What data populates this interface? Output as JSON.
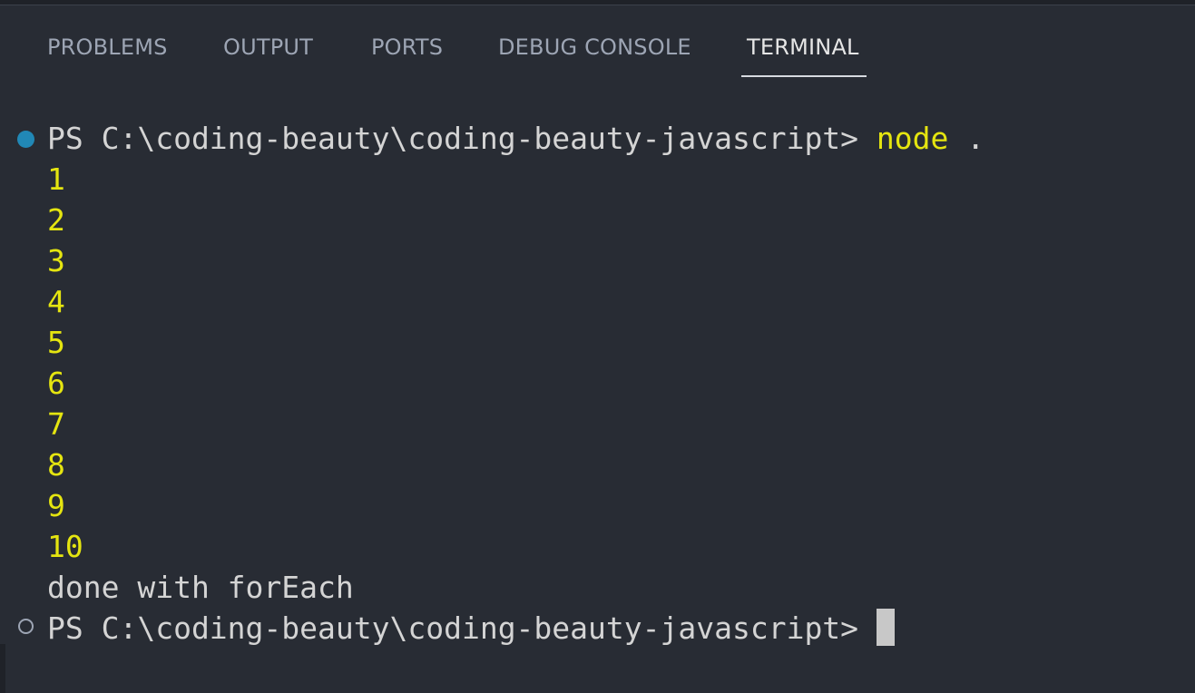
{
  "tabs": [
    {
      "label": "PROBLEMS",
      "active": false
    },
    {
      "label": "OUTPUT",
      "active": false
    },
    {
      "label": "PORTS",
      "active": false
    },
    {
      "label": "DEBUG CONSOLE",
      "active": false
    },
    {
      "label": "TERMINAL",
      "active": true
    }
  ],
  "terminal": {
    "prompt": "PS C:\\coding-beauty\\coding-beauty-javascript> ",
    "command": "node",
    "command_arg": " .",
    "output_numbers": [
      "1",
      "2",
      "3",
      "4",
      "5",
      "6",
      "7",
      "8",
      "9",
      "10"
    ],
    "output_text": "done with forEach",
    "final_prompt": "PS C:\\coding-beauty\\coding-beauty-javascript> "
  },
  "colors": {
    "background": "#282c34",
    "output_yellow": "#e5e510",
    "text": "#d4d4d4",
    "decoration_success": "#2188b6"
  },
  "icons": {
    "command_decoration_done": "circle-filled-icon",
    "command_decoration_pending": "circle-outline-icon"
  }
}
